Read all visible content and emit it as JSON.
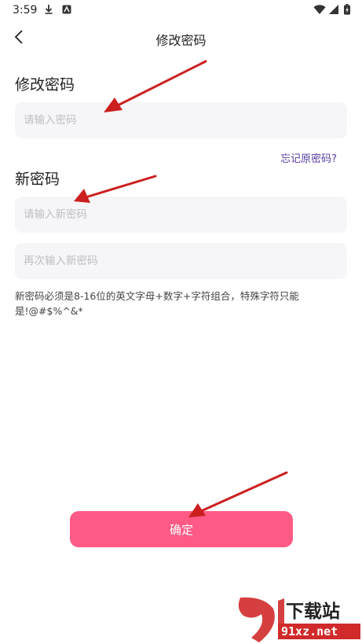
{
  "status_bar": {
    "time": "3:59",
    "icons": [
      "download-icon",
      "app-notification-icon",
      "wifi-icon",
      "signal-icon",
      "battery-icon"
    ]
  },
  "nav": {
    "back_icon": "chevron-left-icon",
    "title": "修改密码"
  },
  "section_old": {
    "title": "修改密码",
    "placeholder": "请输入密码",
    "forgot_link": "忘记原密码?"
  },
  "section_new": {
    "title": "新密码",
    "new_placeholder": "请输入新密码",
    "repeat_placeholder": "再次输入新密码",
    "hint": "新密码必须是8-16位的英文字母+数字+字符组合，特殊字符只能是!@#$%^&*"
  },
  "confirm_label": "确定",
  "watermark": {
    "line1": "下载站",
    "line2": "91xz.net"
  },
  "colors": {
    "accent": "#ff5a85",
    "link": "#5a3ea0",
    "field_bg": "#f6f6f8",
    "annotation_arrow": "#cc1f1f"
  }
}
